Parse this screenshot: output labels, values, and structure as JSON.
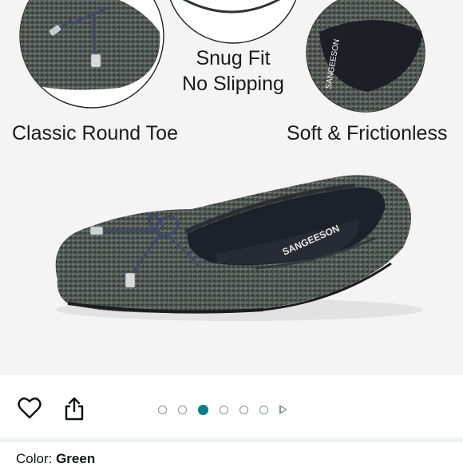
{
  "product_image": {
    "features": {
      "snug_fit_line1": "Snug Fit",
      "snug_fit_line2": "No Slipping",
      "round_toe": "Classic Round Toe",
      "frictionless": "Soft & Frictionless"
    },
    "brand_print": "SANGEESON"
  },
  "toolbar": {
    "wishlist_icon": "heart-outline-icon",
    "share_icon": "share-icon",
    "carousel": {
      "total_images": 6,
      "active_index": 2,
      "has_video_marker": true
    }
  },
  "selection": {
    "color_label": "Color:",
    "color_value": "Green"
  },
  "colors": {
    "accent_dot": "#087d8a",
    "background_image": "#f4f4f4",
    "knit_dark": "#3b4044",
    "knit_light": "#6e7a6a"
  }
}
